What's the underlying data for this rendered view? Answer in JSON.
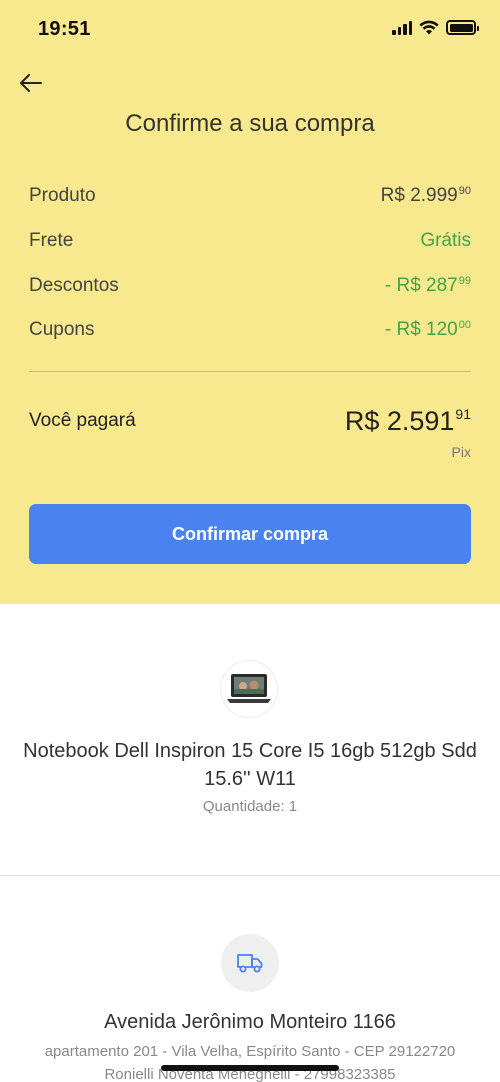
{
  "status_bar": {
    "time": "19:51",
    "battery_level": 1.0
  },
  "header": {
    "title": "Confirme a sua compra"
  },
  "summary": {
    "rows": [
      {
        "label": "Produto",
        "value": "R$ 2.999",
        "cents": "90",
        "color": "#444444"
      },
      {
        "label": "Frete",
        "value": "Grátis",
        "cents": "",
        "color": "#3fa54a"
      },
      {
        "label": "Descontos",
        "value": "- R$ 287",
        "cents": "99",
        "color": "#3fa54a"
      },
      {
        "label": "Cupons",
        "value": "- R$ 120",
        "cents": "00",
        "color": "#3fa54a"
      }
    ],
    "total": {
      "label": "Você pagará",
      "value": "R$ 2.591",
      "cents": "91",
      "method": "Pix"
    }
  },
  "confirm_button": {
    "label": "Confirmar compra",
    "color": "#4a83f0"
  },
  "product": {
    "name": "Notebook Dell Inspiron 15 Core I5 16gb 512gb Sdd 15.6'' W11",
    "quantity": "Quantidade: 1",
    "thumbnail_icon": "laptop-icon"
  },
  "shipping": {
    "icon": "truck-icon",
    "address_line1": "Avenida Jerônimo Monteiro 1166",
    "address_line2": "apartamento 201 - Vila Velha, Espírito Santo - CEP 29122720",
    "address_line3": "Ronielli Noventa Meneghelli - 27998323385"
  },
  "colors": {
    "header_bg": "#f9e98e",
    "accent_blue": "#4a83f0",
    "discount_green": "#3fa54a"
  }
}
